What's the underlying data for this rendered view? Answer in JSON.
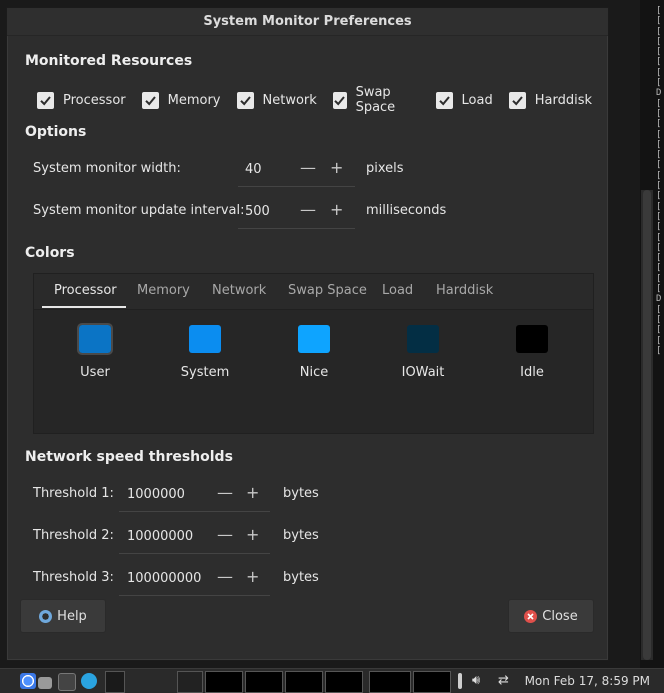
{
  "dialog": {
    "title": "System Monitor Preferences"
  },
  "monitored": {
    "heading": "Monitored Resources",
    "items": [
      "Processor",
      "Memory",
      "Network",
      "Swap Space",
      "Load",
      "Harddisk"
    ]
  },
  "options": {
    "heading": "Options",
    "width_label": "System monitor width:",
    "width_value": "40",
    "width_unit": "pixels",
    "interval_label": "System monitor update interval:",
    "interval_value": "500",
    "interval_unit": "milliseconds",
    "minus": "—",
    "plus": "+"
  },
  "colors": {
    "heading": "Colors",
    "tabs": [
      "Processor",
      "Memory",
      "Network",
      "Swap Space",
      "Load",
      "Harddisk"
    ],
    "active_tab": "Processor",
    "swatches": [
      {
        "label": "User",
        "color": "#0b74c5"
      },
      {
        "label": "System",
        "color": "#0b8df0"
      },
      {
        "label": "Nice",
        "color": "#0ea4ff"
      },
      {
        "label": "IOWait",
        "color": "#032e44"
      },
      {
        "label": "Idle",
        "color": "#000000"
      }
    ]
  },
  "network": {
    "heading": "Network speed thresholds",
    "thresholds": [
      {
        "label": "Threshold 1:",
        "value": "1000000",
        "unit": "bytes"
      },
      {
        "label": "Threshold 2:",
        "value": "10000000",
        "unit": "bytes"
      },
      {
        "label": "Threshold 3:",
        "value": "100000000",
        "unit": "bytes"
      }
    ]
  },
  "buttons": {
    "help": "Help",
    "close": "Close"
  },
  "taskbar": {
    "clock": "Mon Feb 17,  8:59 PM"
  },
  "background": {
    "marks": "[\n[\n[\n[\n[\n[\n[\n[\nD\n[\n[\n[\n[\n[\n[\n[\n[\n[\n[\n[\n[\n[\n[\n[\n[\n[\n[\n[\nD\n[\n[\n[\n[\n[\n[\n[\n[\n[\n["
  }
}
